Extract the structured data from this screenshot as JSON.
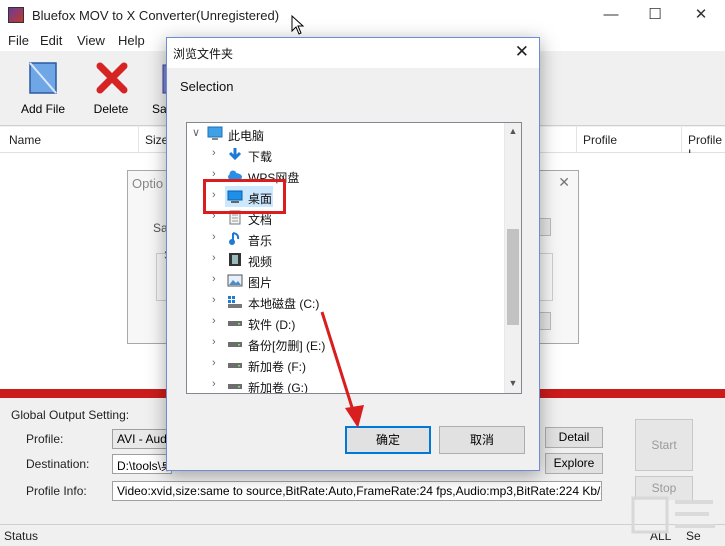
{
  "window": {
    "title": "Bluefox MOV to X Converter(Unregistered)"
  },
  "menu": [
    "File",
    "Edit",
    "View",
    "Help"
  ],
  "toolbar": {
    "add_file": "Add File",
    "delete": "Delete",
    "save_partial": "Sa"
  },
  "list": {
    "columns": [
      "Name",
      "Size",
      "Profile",
      "Profile I"
    ]
  },
  "options_dialog": {
    "title": "Optio",
    "save_partial": "Sa",
    "s_partial": "S"
  },
  "bottom": {
    "heading": "Global Output Setting:",
    "profile_label": "Profile:",
    "profile_value": "AVI - Audio",
    "destination_label": "Destination:",
    "destination_value": "D:\\tools\\桌",
    "info_label": "Profile Info:",
    "info_value": "Video:xvid,size:same to source,BitRate:Auto,FrameRate:24 fps,Audio:mp3,BitRate:224 Kb/s,Sample Ra",
    "detail_button": "Detail",
    "explore_button": "Explore",
    "start_button": "Start",
    "stop_button": "Stop"
  },
  "status": {
    "label": "Status",
    "all": "ALL",
    "se": "Se"
  },
  "browse_dialog": {
    "title": "浏览文件夹",
    "selection_label": "Selection",
    "tree": [
      {
        "label": "此电脑",
        "icon": "computer-icon"
      },
      {
        "label": "下载",
        "icon": "download-icon"
      },
      {
        "label": "WPS网盘",
        "icon": "cloud-icon"
      },
      {
        "label": "桌面",
        "icon": "desktop-icon",
        "selected": true
      },
      {
        "label": "文档",
        "icon": "document-icon"
      },
      {
        "label": "音乐",
        "icon": "music-icon"
      },
      {
        "label": "视频",
        "icon": "video-icon"
      },
      {
        "label": "图片",
        "icon": "picture-icon"
      },
      {
        "label": "本地磁盘 (C:)",
        "icon": "system-drive-icon"
      },
      {
        "label": "软件 (D:)",
        "icon": "drive-icon"
      },
      {
        "label": "备份[勿删] (E:)",
        "icon": "drive-icon"
      },
      {
        "label": "新加卷 (F:)",
        "icon": "drive-icon"
      },
      {
        "label": "新加卷 (G:)",
        "icon": "drive-icon"
      }
    ],
    "ok_button": "确定",
    "cancel_button": "取消"
  },
  "colors": {
    "accent_red": "#cc1b1b",
    "highlight_red": "#d81e1e",
    "focus_blue": "#0078d7"
  }
}
